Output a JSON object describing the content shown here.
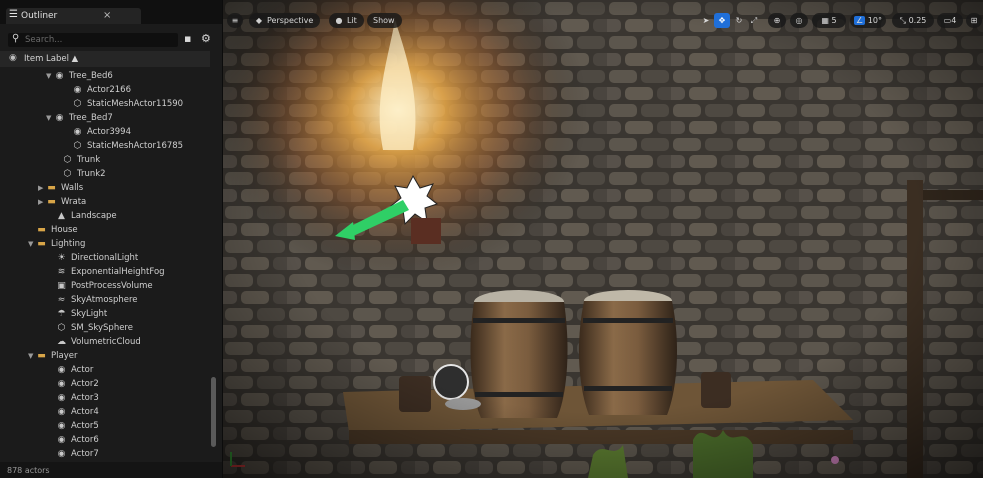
{
  "outliner": {
    "tab_icon": "☰",
    "tab_title": "Outliner",
    "tab_close": "×",
    "search_placeholder": "Search...",
    "search_icon": "search-icon",
    "header_label": "Item Label ▲",
    "footer": "878 actors",
    "rows": [
      {
        "label": "Tree_Bed6",
        "toggle": "▼",
        "icon": "actor-icon",
        "glyph": "◉"
      },
      {
        "label": "Actor2166",
        "toggle": "",
        "icon": "actor-icon",
        "glyph": "◉"
      },
      {
        "label": "StaticMeshActor11590",
        "toggle": "",
        "icon": "static-mesh-icon",
        "glyph": "⬡"
      },
      {
        "label": "Tree_Bed7",
        "toggle": "▼",
        "icon": "actor-icon",
        "glyph": "◉"
      },
      {
        "label": "Actor3994",
        "toggle": "",
        "icon": "actor-icon",
        "glyph": "◉"
      },
      {
        "label": "StaticMeshActor16785",
        "toggle": "",
        "icon": "static-mesh-icon",
        "glyph": "⬡"
      },
      {
        "label": "Trunk",
        "toggle": "",
        "icon": "static-mesh-icon",
        "glyph": "⬡"
      },
      {
        "label": "Trunk2",
        "toggle": "",
        "icon": "static-mesh-icon",
        "glyph": "⬡"
      },
      {
        "label": "Walls",
        "toggle": "▶",
        "icon": "folder-icon",
        "glyph": "▬"
      },
      {
        "label": "Wrata",
        "toggle": "▶",
        "icon": "folder-icon",
        "glyph": "▬"
      },
      {
        "label": "Landscape",
        "toggle": "",
        "icon": "landscape-icon",
        "glyph": "▲"
      },
      {
        "label": "House",
        "toggle": "",
        "icon": "folder-icon",
        "glyph": "▬"
      },
      {
        "label": "Lighting",
        "toggle": "▼",
        "icon": "folder-icon",
        "glyph": "▬"
      },
      {
        "label": "DirectionalLight",
        "toggle": "",
        "icon": "directional-light-icon",
        "glyph": "☀"
      },
      {
        "label": "ExponentialHeightFog",
        "toggle": "",
        "icon": "fog-icon",
        "glyph": "≋"
      },
      {
        "label": "PostProcessVolume",
        "toggle": "",
        "icon": "post-process-icon",
        "glyph": "▣"
      },
      {
        "label": "SkyAtmosphere",
        "toggle": "",
        "icon": "sky-atmosphere-icon",
        "glyph": "≈"
      },
      {
        "label": "SkyLight",
        "toggle": "",
        "icon": "sky-light-icon",
        "glyph": "☂"
      },
      {
        "label": "SM_SkySphere",
        "toggle": "",
        "icon": "static-mesh-icon",
        "glyph": "⬡"
      },
      {
        "label": "VolumetricCloud",
        "toggle": "",
        "icon": "cloud-icon",
        "glyph": "☁"
      },
      {
        "label": "Player",
        "toggle": "▼",
        "icon": "folder-icon",
        "glyph": "▬"
      },
      {
        "label": "Actor",
        "toggle": "",
        "icon": "actor-icon",
        "glyph": "◉"
      },
      {
        "label": "Actor2",
        "toggle": "",
        "icon": "actor-icon",
        "glyph": "◉"
      },
      {
        "label": "Actor3",
        "toggle": "",
        "icon": "actor-icon",
        "glyph": "◉"
      },
      {
        "label": "Actor4",
        "toggle": "",
        "icon": "actor-icon",
        "glyph": "◉"
      },
      {
        "label": "Actor5",
        "toggle": "",
        "icon": "actor-icon",
        "glyph": "◉"
      },
      {
        "label": "Actor6",
        "toggle": "",
        "icon": "actor-icon",
        "glyph": "◉"
      },
      {
        "label": "Actor7",
        "toggle": "",
        "icon": "actor-icon",
        "glyph": "◉"
      }
    ]
  },
  "viewport": {
    "perspective_label": "Perspective",
    "lit_label": "Lit",
    "show_label": "Show",
    "grid_snap": "5",
    "rotation_snap": "10°",
    "scale_snap": "0.25",
    "camera_speed": "4"
  }
}
